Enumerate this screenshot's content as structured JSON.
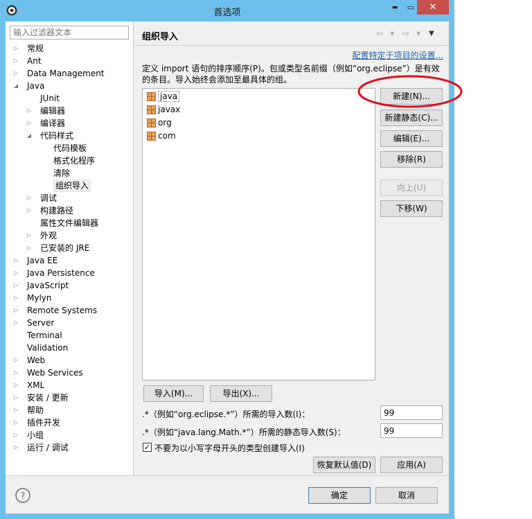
{
  "window": {
    "title": "首选项",
    "close_glyph": "✕",
    "min_glyph": "▬",
    "max_glyph": "▭"
  },
  "filter": {
    "placeholder": "输入过滤器文本"
  },
  "tree": [
    {
      "label": "常规"
    },
    {
      "label": "Ant"
    },
    {
      "label": "Data Management"
    },
    {
      "label": "Java"
    },
    {
      "label": "JUnit"
    },
    {
      "label": "编辑器"
    },
    {
      "label": "编译器"
    },
    {
      "label": "代码样式"
    },
    {
      "label": "代码模板"
    },
    {
      "label": "格式化程序"
    },
    {
      "label": "清除"
    },
    {
      "label": "组织导入"
    },
    {
      "label": "调试"
    },
    {
      "label": "构建路径"
    },
    {
      "label": "属性文件编辑器"
    },
    {
      "label": "外观"
    },
    {
      "label": "已安装的 JRE"
    },
    {
      "label": "Java EE"
    },
    {
      "label": "Java Persistence"
    },
    {
      "label": "JavaScript"
    },
    {
      "label": "Mylyn"
    },
    {
      "label": "Remote Systems"
    },
    {
      "label": "Server"
    },
    {
      "label": "Terminal"
    },
    {
      "label": "Validation"
    },
    {
      "label": "Web"
    },
    {
      "label": "Web Services"
    },
    {
      "label": "XML"
    },
    {
      "label": "安装 / 更新"
    },
    {
      "label": "帮助"
    },
    {
      "label": "插件开发"
    },
    {
      "label": "小组"
    },
    {
      "label": "运行 / 调试"
    }
  ],
  "page": {
    "title": "组织导入",
    "link": "配置特定于项目的设置...",
    "description": "定义 import 语句的排序顺序(P)。包或类型名前缀（例如“org.eclipse”）是有效的条目。导入始终会添加至最具体的组。",
    "packages": [
      "java",
      "javax",
      "org",
      "com"
    ],
    "buttons": {
      "new": "新建(N)...",
      "new_static": "新建静态(C)...",
      "edit": "编辑(E)...",
      "remove": "移除(R)",
      "up": "向上(U)",
      "down": "下移(W)",
      "import": "导入(M)...",
      "export": "导出(X)...",
      "restore": "恢复默认值(D)",
      "apply": "应用(A)"
    },
    "import_count_label": ".*（例如“org.eclipse.*”）所需的导入数(I)：",
    "import_count": "99",
    "static_count_label": ".*（例如“java.lang.Math.*”）所需的静态导入数(S)：",
    "static_count": "99",
    "lowercase_label": "不要为以小写字母开头的类型创建导入(I)",
    "lowercase_checked": true
  },
  "footer": {
    "ok": "确定",
    "cancel": "取消"
  },
  "colors": {
    "titlebar": "#6ec0ec",
    "close": "#c7514a",
    "link": "#1f5fa8",
    "annotation": "#e0101a"
  }
}
